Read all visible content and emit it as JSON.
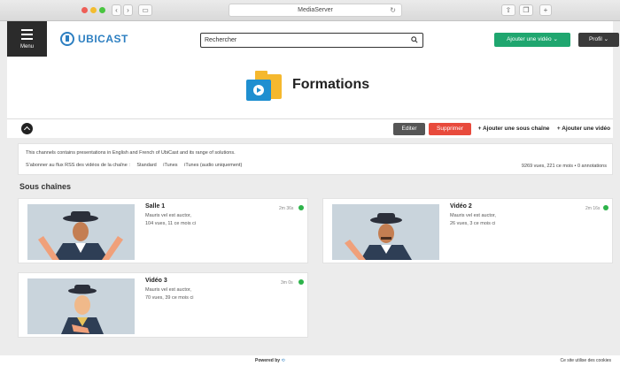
{
  "browser": {
    "url": "MediaServer"
  },
  "header": {
    "menu_label": "Menu",
    "logo_text": "UBICAST",
    "search_placeholder": "Rechercher",
    "add_video_label": "Ajouter une vidéo",
    "profile_label": "Profil"
  },
  "page": {
    "title": "Formations"
  },
  "toolbar": {
    "edit": "Editer",
    "delete": "Supprimer",
    "add_subchannel": "Ajouter une sous chaîne",
    "add_video": "Ajouter une vidéo"
  },
  "info": {
    "description": "This channels contains presentations in English and French of UbiCast and its range of solutions.",
    "rss_label": "S'abonner au flux RSS des vidéos de la chaîne :",
    "rss_standard": "Standard",
    "rss_itunes": "iTunes",
    "rss_itunes_audio": "iTunes (audio uniquement)",
    "stats": "9269 vues, 221 ce mois • 0 annotations"
  },
  "section_title": "Sous chaînes",
  "cards": [
    {
      "title": "Salle 1",
      "line1": "Mauris vel est auctor,",
      "line2": "104 vues, 11 ce mois ci",
      "time": "2m 36s"
    },
    {
      "title": "Vidéo 2",
      "line1": "Mauris vel est auctor,",
      "line2": "26 vues, 3 ce mois ci",
      "time": "2m 16s"
    },
    {
      "title": "Vidéo 3",
      "line1": "Mauris vel est auctor,",
      "line2": "70 vues, 39 ce mois ci",
      "time": "3m 0s"
    }
  ],
  "footer": {
    "powered": "Powered by",
    "cookies": "Ce site utilise des cookies"
  },
  "colors": {
    "accent_green": "#1fa66f",
    "danger": "#e84a3c",
    "brand_blue": "#2d7fc1"
  }
}
